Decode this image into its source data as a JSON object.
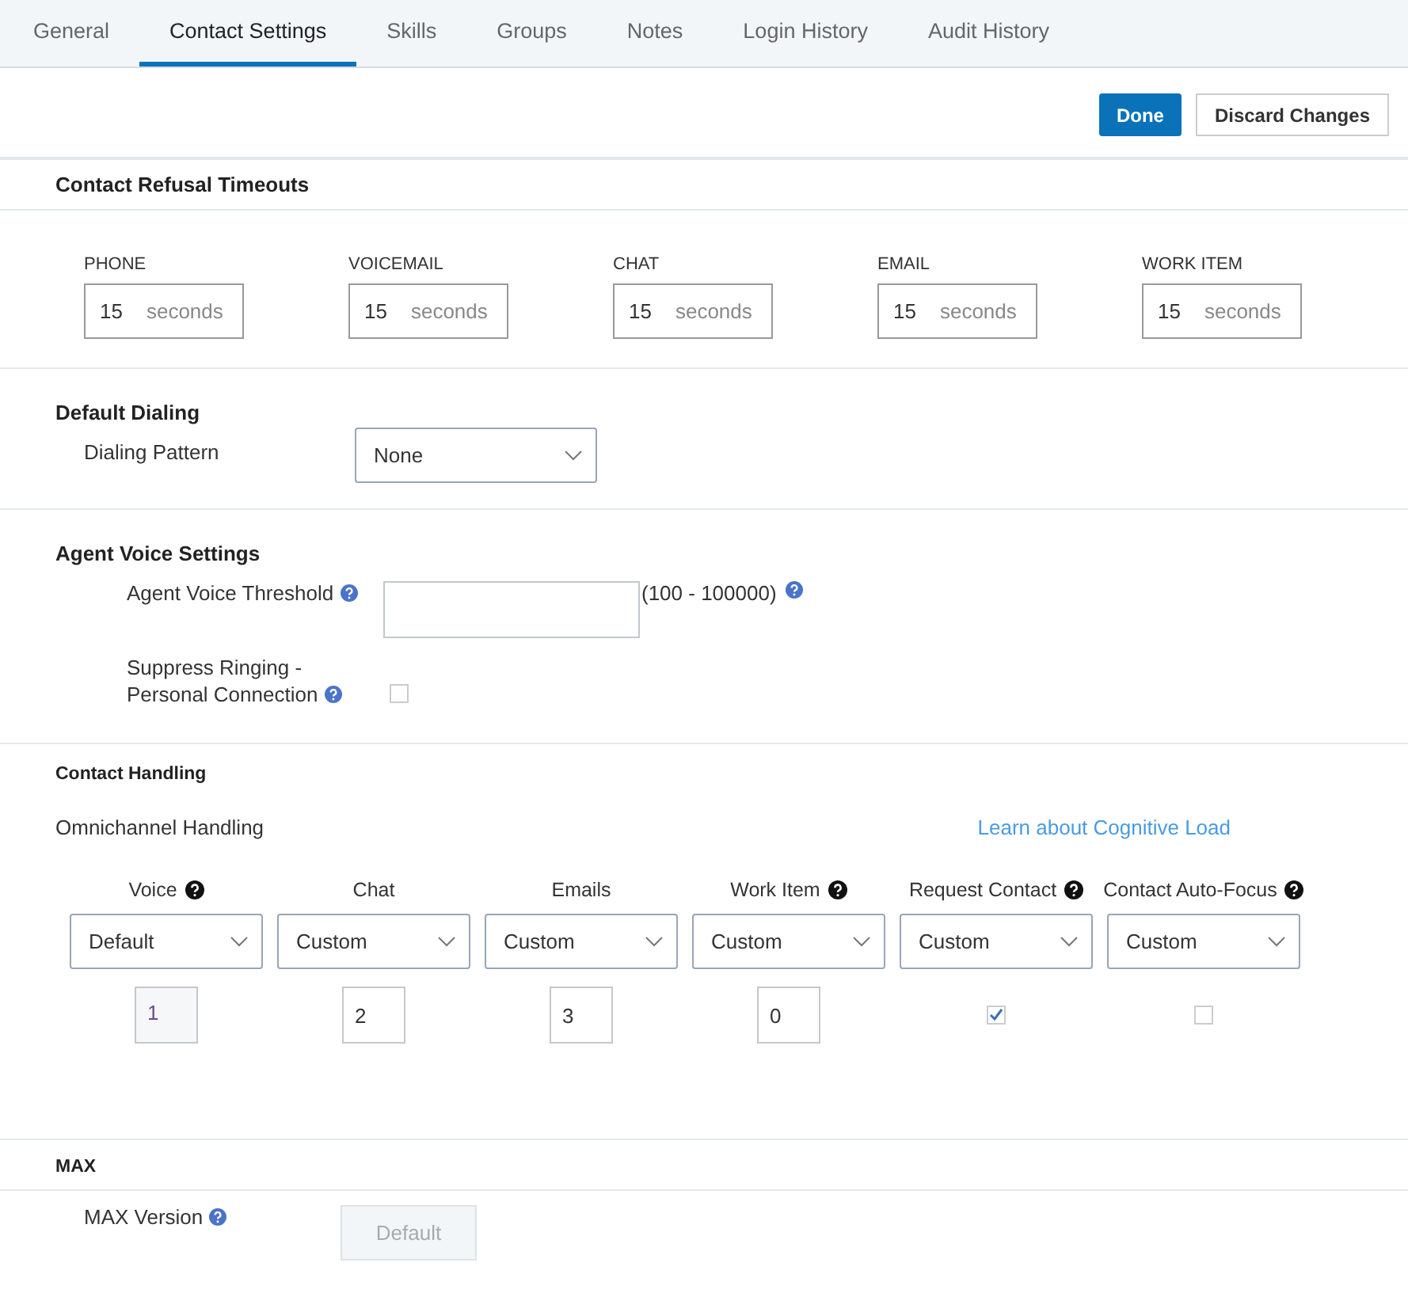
{
  "tabs": [
    {
      "label": "General",
      "selected": false
    },
    {
      "label": "Contact Settings",
      "selected": true
    },
    {
      "label": "Skills",
      "selected": false
    },
    {
      "label": "Groups",
      "selected": false
    },
    {
      "label": "Notes",
      "selected": false
    },
    {
      "label": "Login History",
      "selected": false
    },
    {
      "label": "Audit History",
      "selected": false
    }
  ],
  "actions": {
    "primary": "Done",
    "secondary": "Discard Changes"
  },
  "refusal": {
    "title": "Contact Refusal Timeouts",
    "fields": [
      {
        "label": "PHONE",
        "value": "15",
        "unit": "seconds"
      },
      {
        "label": "VOICEMAIL",
        "value": "15",
        "unit": "seconds"
      },
      {
        "label": "CHAT",
        "value": "15",
        "unit": "seconds"
      },
      {
        "label": "EMAIL",
        "value": "15",
        "unit": "seconds"
      },
      {
        "label": "WORK ITEM",
        "value": "15",
        "unit": "seconds"
      }
    ]
  },
  "dialing": {
    "title": "Default Dialing",
    "label": "Dialing Pattern",
    "value": "None"
  },
  "voice": {
    "title": "Agent Voice Settings",
    "threshold_label": "Agent Voice Threshold",
    "range": "(100 - 100000)",
    "suppress_label_1": "Suppress Ringing -",
    "suppress_label_2": "Personal Connection",
    "suppress_checked": false
  },
  "handling": {
    "title": "Contact Handling",
    "subtitle": "Omnichannel Handling",
    "link": "Learn about Cognitive Load",
    "channels": [
      {
        "label": "Voice",
        "help": true,
        "option": "Default",
        "kind": "number",
        "value": "1",
        "disabled": true
      },
      {
        "label": "Chat",
        "help": false,
        "option": "Custom",
        "kind": "number",
        "value": "2",
        "disabled": false
      },
      {
        "label": "Emails",
        "help": false,
        "option": "Custom",
        "kind": "number",
        "value": "3",
        "disabled": false
      },
      {
        "label": "Work Item",
        "help": true,
        "option": "Custom",
        "kind": "number",
        "value": "0",
        "disabled": false
      },
      {
        "label": "Request Contact",
        "help": true,
        "option": "Custom",
        "kind": "checkbox",
        "checked": true
      },
      {
        "label": "Contact Auto-Focus",
        "help": true,
        "option": "Custom",
        "kind": "checkbox",
        "checked": false
      }
    ]
  },
  "max": {
    "title": "MAX",
    "label": "MAX Version",
    "value": "Default"
  }
}
